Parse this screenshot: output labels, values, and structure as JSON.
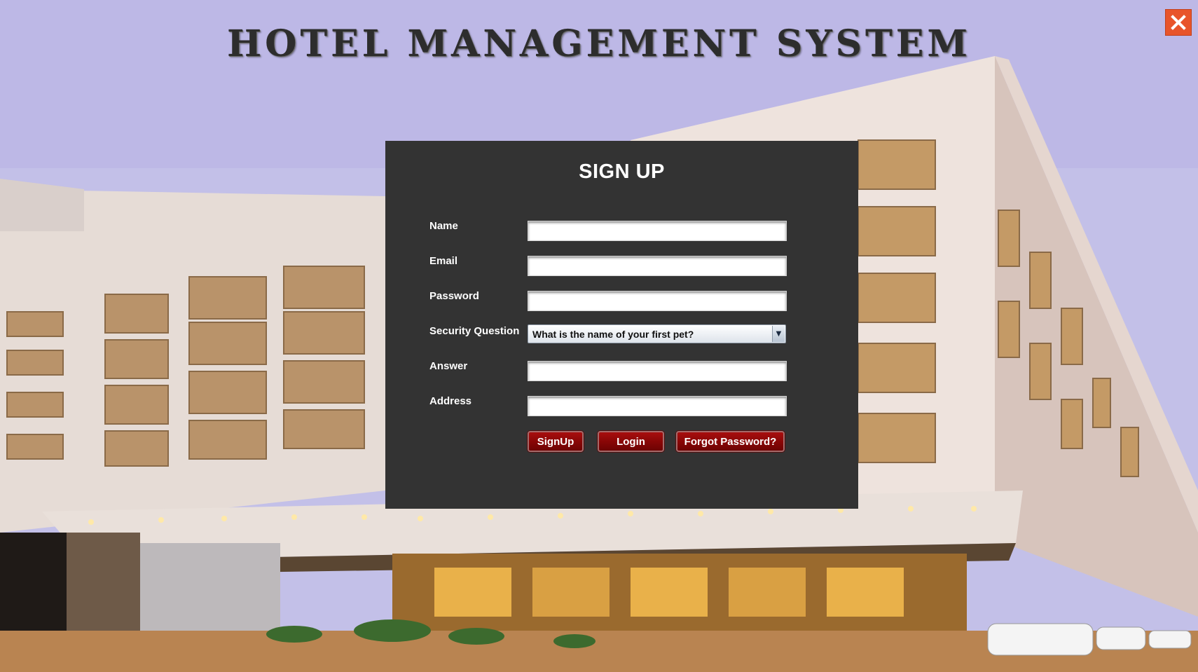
{
  "app": {
    "title": "HOTEL MANAGEMENT SYSTEM",
    "close_icon": "close-icon"
  },
  "form": {
    "title": "SIGN UP",
    "fields": [
      {
        "label": "Name",
        "value": "",
        "placeholder": ""
      },
      {
        "label": "Email",
        "value": "",
        "placeholder": ""
      },
      {
        "label": "Password",
        "value": "",
        "placeholder": ""
      },
      {
        "label": "Security Question",
        "value": "What is the name of your first pet?"
      },
      {
        "label": "Answer",
        "value": "",
        "placeholder": ""
      },
      {
        "label": "Address",
        "value": "",
        "placeholder": ""
      }
    ],
    "buttons": {
      "signup": "SignUp",
      "login": "Login",
      "forgot": "Forgot Password?"
    }
  },
  "colors": {
    "panel": "#333333",
    "button": "#8b0a0a",
    "close": "#e8542a"
  }
}
